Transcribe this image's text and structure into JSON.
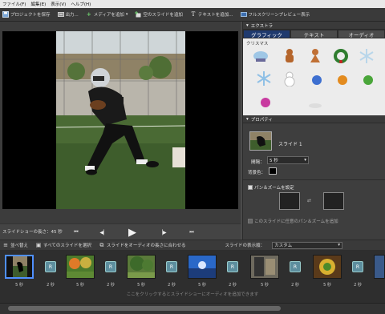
{
  "menu": [
    "ファイル(F)",
    "編集(E)",
    "表示(V)",
    "ヘルプ(H)"
  ],
  "toolbar": {
    "save": "プロジェクトを保存",
    "output": "出力...",
    "add_media": "メディアを追加",
    "add_blank": "空のスライドを追加",
    "add_text": "テキストを追加...",
    "fullscreen": "フルスクリーンプレビュー表示"
  },
  "player": {
    "length": "スライドショーの長さ：45 秒"
  },
  "extras": {
    "title": "エクストラ",
    "tabs": [
      "グラフィック",
      "テキスト",
      "オーディオ"
    ],
    "category": "クリスマス"
  },
  "properties": {
    "title": "プロパティ",
    "slide_name": "スライド 1",
    "duration_label": "間隔：",
    "duration_value": "5 秒",
    "bg_label": "背景色：",
    "panzoom_label": "パン＆ズームを設定",
    "random_label": "このスライドに任意のパン＆ズームを追加",
    "colors": {
      "bg_swatch": "#000000"
    }
  },
  "footer": {
    "reorder": "並べ替え",
    "select_all": "すべてのスライドを選択",
    "fit_audio": "スライドをオーディオの長さに合わせる",
    "display_label": "スライドの表示順：",
    "display_value": "カスタム"
  },
  "strip": {
    "slides": [
      {
        "dur": "5 秒"
      },
      {
        "dur": "5 秒"
      },
      {
        "dur": "5 秒"
      },
      {
        "dur": "5 秒"
      },
      {
        "dur": "5 秒"
      },
      {
        "dur": "5 秒"
      },
      {
        "dur": "5 秒"
      }
    ],
    "transitions": [
      {
        "dur": "2 秒"
      },
      {
        "dur": "2 秒"
      },
      {
        "dur": "2 秒"
      },
      {
        "dur": "2 秒"
      },
      {
        "dur": "2 秒"
      },
      {
        "dur": "2 秒"
      },
      {
        "dur": "2 秒"
      }
    ],
    "hint": "ここをクリックするとスライドショーにオーディオを追加できます"
  },
  "accent": "#1f3a6e"
}
